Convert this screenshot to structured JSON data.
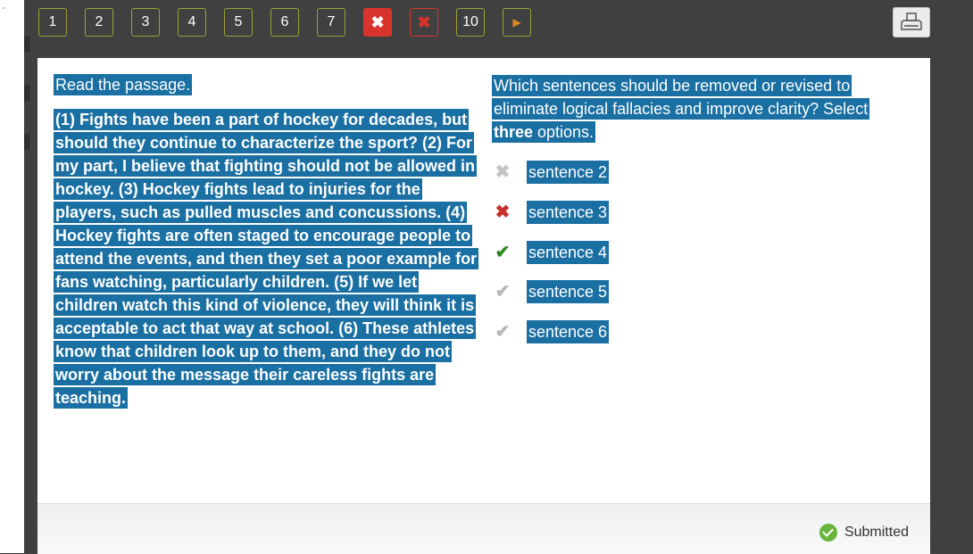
{
  "nav": {
    "questions": [
      {
        "label": "1",
        "state": "default"
      },
      {
        "label": "2",
        "state": "default"
      },
      {
        "label": "3",
        "state": "default"
      },
      {
        "label": "4",
        "state": "default"
      },
      {
        "label": "5",
        "state": "default"
      },
      {
        "label": "6",
        "state": "default"
      },
      {
        "label": "7",
        "state": "default"
      },
      {
        "label": "✖",
        "state": "incorrect-current"
      },
      {
        "label": "✖",
        "state": "incorrect"
      },
      {
        "label": "10",
        "state": "default"
      }
    ],
    "next_icon": "▶",
    "print_icon": "printer-icon"
  },
  "passage": {
    "intro": "Read the passage.",
    "text": "(1) Fights have been a part of hockey for decades, but should they continue to characterize the sport? (2) For my part, I believe that fighting should not be allowed in hockey. (3) Hockey fights lead to injuries for the players, such as pulled muscles and concussions. (4) Hockey fights are often staged to encourage people to attend the events, and then they set a poor example for fans watching, particularly children. (5) If we let children watch this kind of violence, they will think it is acceptable to act that way at school. (6) These athletes know that children look up to them, and they do not worry about the message their careless fights are teaching."
  },
  "question": {
    "text_before": "Which sentences should be removed or revised to eliminate logical fallacies and improve clarity? Select ",
    "bold": "three",
    "text_after": " options.",
    "options": [
      {
        "label": "sentence 2",
        "mark": "✖",
        "mark_type": "gray-x"
      },
      {
        "label": "sentence 3",
        "mark": "✖",
        "mark_type": "red-x"
      },
      {
        "label": "sentence 4",
        "mark": "✔",
        "mark_type": "green-check"
      },
      {
        "label": "sentence 5",
        "mark": "✔",
        "mark_type": "gray-check"
      },
      {
        "label": "sentence 6",
        "mark": "✔",
        "mark_type": "gray-check"
      }
    ]
  },
  "footer": {
    "status": "Submitted"
  },
  "colors": {
    "highlight": "#1a6fa3",
    "nav_border": "#9aa336",
    "incorrect": "#d9342b",
    "correct": "#2a8a1f"
  }
}
